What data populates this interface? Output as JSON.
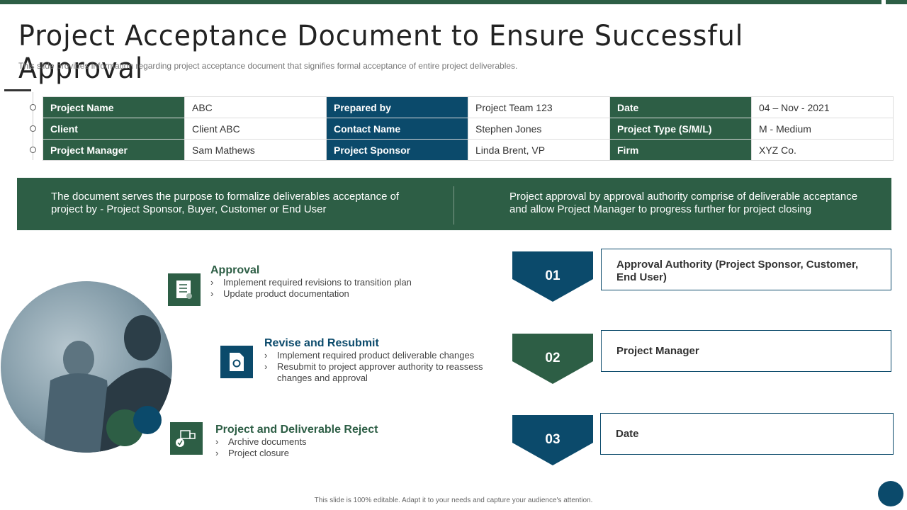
{
  "title": "Project Acceptance Document to Ensure Successful Approval",
  "subtitle": "This slide provides information regarding project acceptance document that signifies formal acceptance of entire project deliverables.",
  "info_table": [
    [
      {
        "label": "Project Name",
        "value": "ABC"
      },
      {
        "label": "Prepared by",
        "value": "Project Team 123"
      },
      {
        "label": "Date",
        "value": "04 – Nov  - 2021"
      }
    ],
    [
      {
        "label": "Client",
        "value": "Client ABC"
      },
      {
        "label": "Contact Name",
        "value": "Stephen Jones"
      },
      {
        "label": "Project Type (S/M/L)",
        "value": "M - Medium"
      }
    ],
    [
      {
        "label": "Project Manager",
        "value": "Sam Mathews"
      },
      {
        "label": "Project Sponsor",
        "value": "Linda Brent, VP"
      },
      {
        "label": "Firm",
        "value": "XYZ Co."
      }
    ]
  ],
  "banner": {
    "left": "The document serves the purpose to formalize deliverables acceptance of project by - Project Sponsor, Buyer, Customer or End User",
    "right": "Project approval by approval authority comprise of deliverable acceptance and allow Project Manager to progress further for project closing"
  },
  "outcomes": [
    {
      "heading": "Approval",
      "items": [
        "Implement  required  revisions  to transition plan",
        "Update  product  documentation"
      ]
    },
    {
      "heading": "Revise and Resubmit",
      "items": [
        "Implement  required  product  deliverable   changes",
        "Resubmit to project  approver  authority to reassess changes  and approval"
      ]
    },
    {
      "heading": "Project and Deliverable Reject",
      "items": [
        "Archive  documents",
        "Project closure"
      ]
    }
  ],
  "steps": [
    {
      "number": "01",
      "label": "Approval Authority (Project Sponsor, Customer, End User)"
    },
    {
      "number": "02",
      "label": "Project Manager"
    },
    {
      "number": "03",
      "label": "Date"
    }
  ],
  "footer": "This slide is 100% editable. Adapt it to your needs and capture your audience's attention.",
  "colors": {
    "green": "#2d5e45",
    "blue": "#0b4a6b"
  }
}
